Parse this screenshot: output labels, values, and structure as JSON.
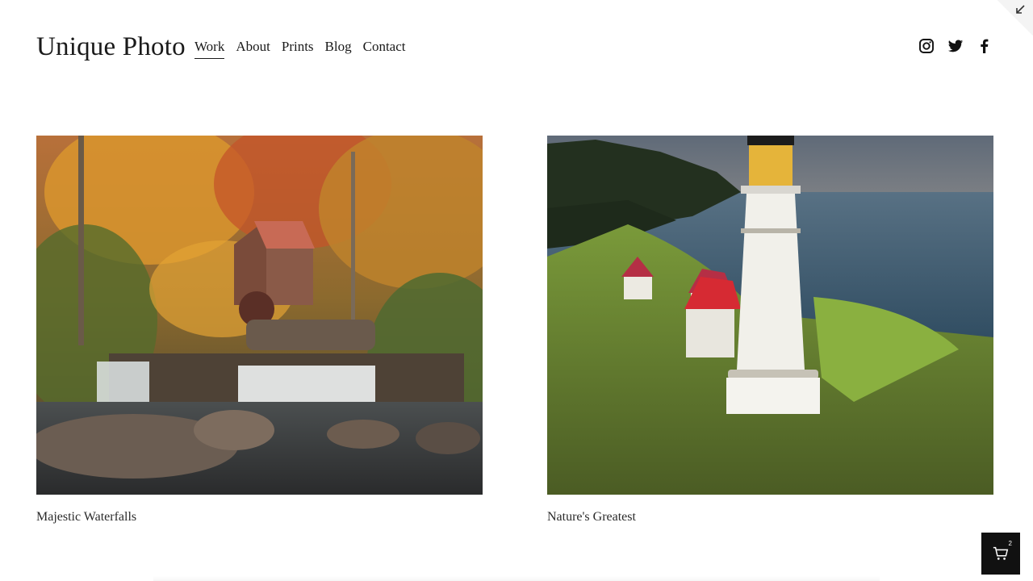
{
  "site": {
    "title": "Unique Photo"
  },
  "nav": {
    "items": [
      {
        "label": "Work",
        "active": true
      },
      {
        "label": "About",
        "active": false
      },
      {
        "label": "Prints",
        "active": false
      },
      {
        "label": "Blog",
        "active": false
      },
      {
        "label": "Contact",
        "active": false
      }
    ]
  },
  "social": {
    "icons": [
      "instagram-icon",
      "twitter-icon",
      "facebook-icon"
    ]
  },
  "gallery": {
    "items": [
      {
        "caption": "Majestic Waterfalls",
        "image": "autumn-waterfall-mill-photo"
      },
      {
        "caption": "Nature's Greatest",
        "image": "coastal-lighthouse-photo"
      }
    ]
  },
  "cart": {
    "count": "2"
  },
  "colors": {
    "text": "#1a1a1a",
    "background": "#ffffff",
    "cart_bg": "#111111"
  }
}
